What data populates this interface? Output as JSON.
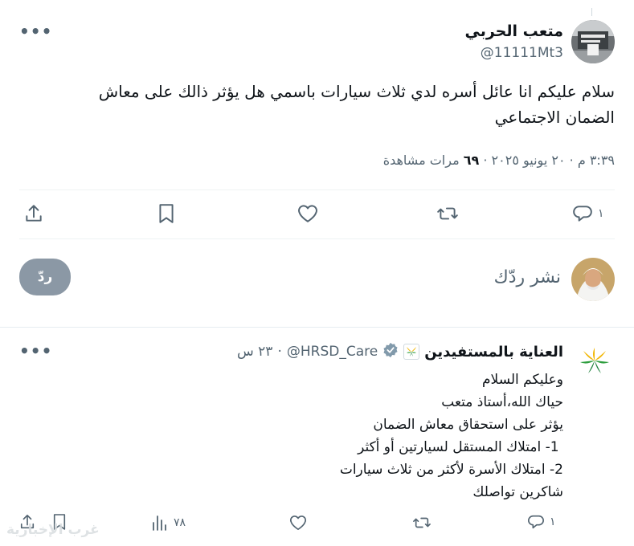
{
  "tweet": {
    "author_name": "متعب الحربي",
    "author_handle": "@11111Mt3",
    "text_line1": "سلام عليكم انا عائل أسره لدي ثلاث سيارات باسمي هل يؤثر ذالك على معاش",
    "text_line2": "الضمان الاجتماعي",
    "time": "٣:٣٩ م",
    "sep1": "·",
    "date": "٢٠ يونيو ٢٠٢٥",
    "sep2": "·",
    "views_count": "٦٩",
    "views_label": "مرات مشاهدة",
    "reply_count": "١"
  },
  "compose": {
    "placeholder": "نشر ردّك",
    "button_label": "ردّ"
  },
  "reply": {
    "author_name": "العناية بالمستفيدين",
    "author_handle": "@HRSD_Care",
    "sep": "·",
    "time": "٢٣ س",
    "lines": [
      "وعليكم السلام",
      "حياك الله،أستاذ متعب",
      "يؤثر على استحقاق معاش الضمان",
      " 1- امتلاك المستقل لسيارتين أو أكثر",
      "2- امتلاك الأسرة لأكثر من ثلاث سيارات",
      "شاكرين تواصلك"
    ],
    "reply_count": "١",
    "views_count": "٧٨"
  },
  "watermark": "غرب الإخبارية",
  "colors": {
    "icon_gray": "#536471",
    "divider": "#eff3f4",
    "verified_blue": "#1d9bf0",
    "reply_button": "#8b98a5"
  },
  "icons": {
    "more": "more-horizontal-icon",
    "reply": "speech-bubble-icon",
    "retweet": "retweet-icon",
    "like": "heart-icon",
    "bookmark": "bookmark-icon",
    "share": "share-upload-icon",
    "views": "bar-chart-icon",
    "verified": "verified-badge-icon"
  }
}
